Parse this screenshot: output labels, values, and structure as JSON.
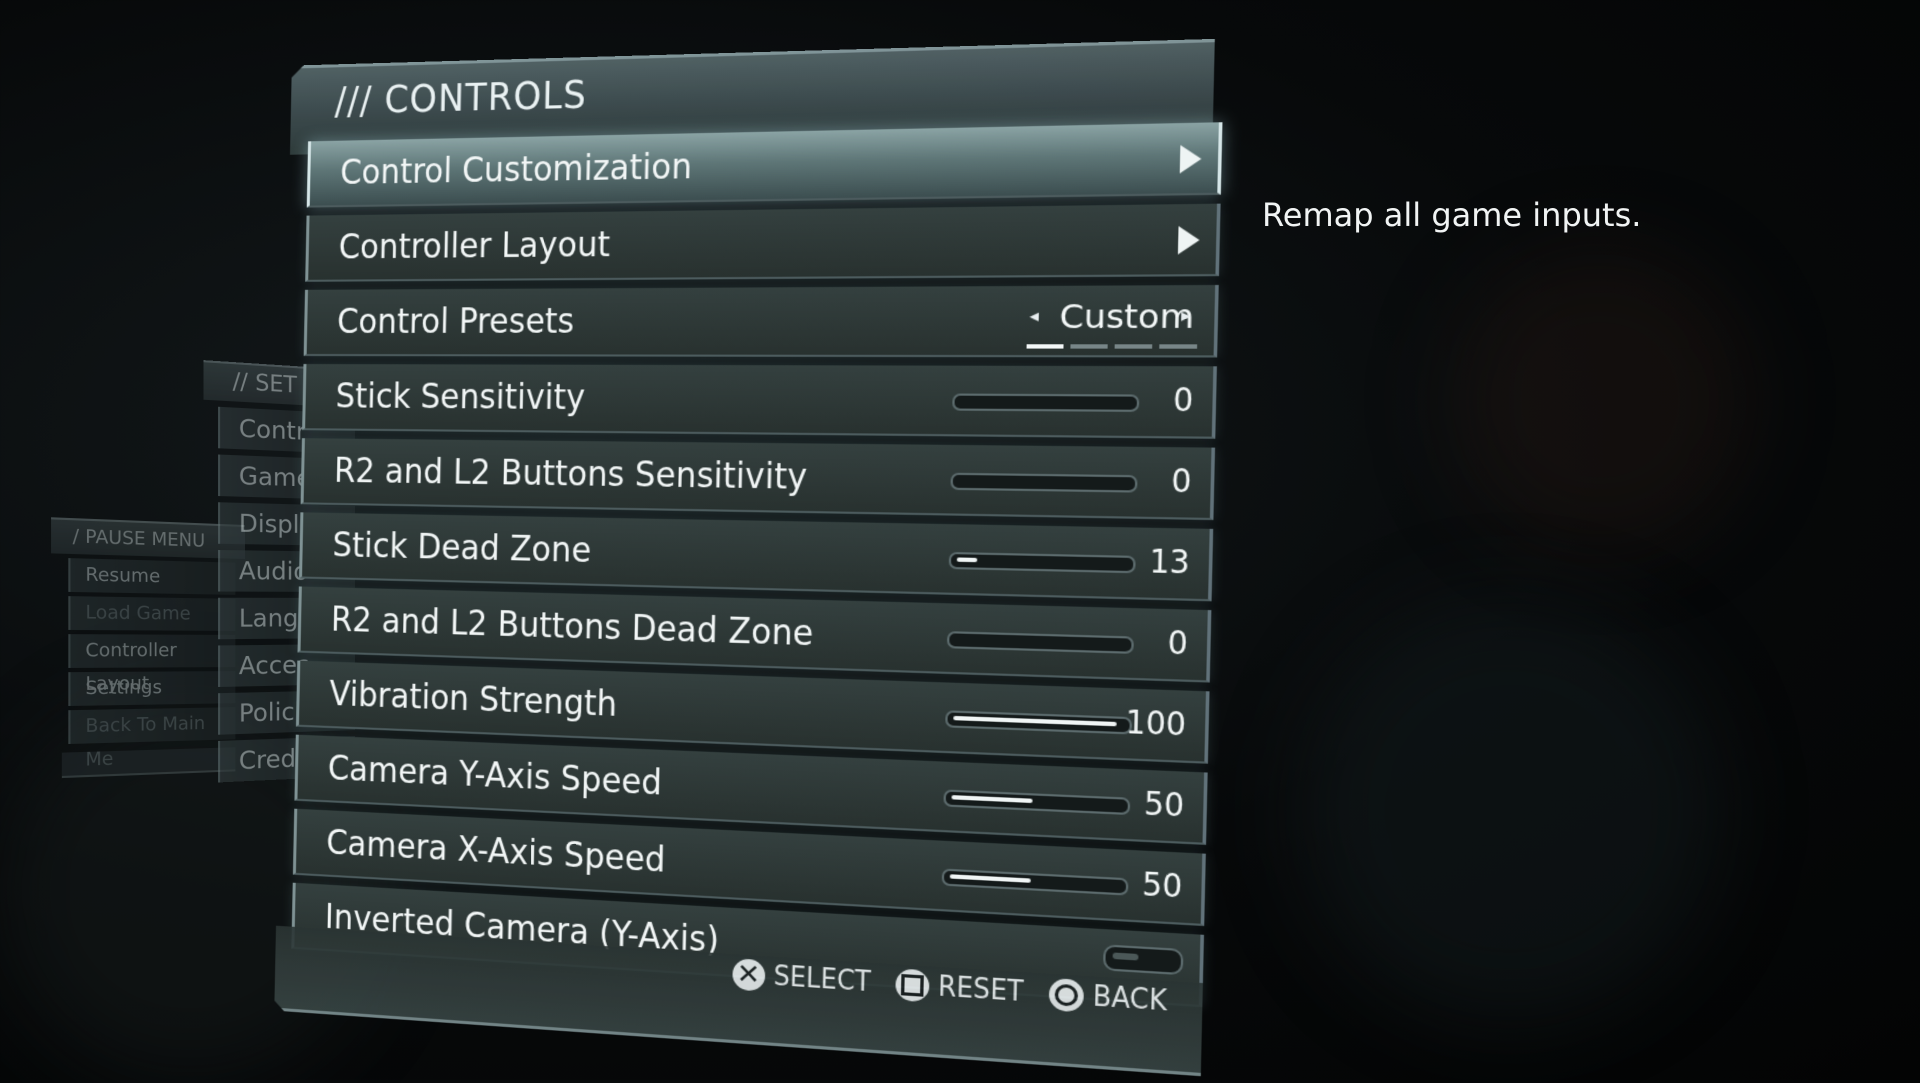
{
  "description": "Remap all game inputs.",
  "pause_menu": {
    "title": "/ PAUSE MENU",
    "items": [
      "Resume",
      "Load Game",
      "Controller Layout",
      "Settings",
      "Back To Main Me"
    ]
  },
  "settings_menu": {
    "title": "// SET",
    "items": [
      "Contr",
      "Game",
      "Displa",
      "Audio",
      "Langu",
      "Acces",
      "Policie",
      "Credit"
    ]
  },
  "controls": {
    "title": "/// CONTROLS",
    "rows": [
      {
        "label": "Control Customization",
        "type": "arrow",
        "selected": true
      },
      {
        "label": "Controller Layout",
        "type": "arrow"
      },
      {
        "label": "Control Presets",
        "type": "selector",
        "value": "Custom"
      },
      {
        "label": "Stick Sensitivity",
        "type": "slider",
        "value": "0",
        "fraction": 0
      },
      {
        "label": "R2 and L2 Buttons Sensitivity",
        "type": "slider",
        "value": "0",
        "fraction": 0
      },
      {
        "label": "Stick Dead Zone",
        "type": "slider",
        "value": "13",
        "fraction": 0.13
      },
      {
        "label": "R2 and L2 Buttons Dead Zone",
        "type": "slider",
        "value": "0",
        "fraction": 0
      },
      {
        "label": "Vibration Strength",
        "type": "slider",
        "value": "100",
        "fraction": 1
      },
      {
        "label": "Camera Y-Axis Speed",
        "type": "slider",
        "value": "50",
        "fraction": 0.5
      },
      {
        "label": "Camera X-Axis Speed",
        "type": "slider",
        "value": "50",
        "fraction": 0.5
      },
      {
        "label": "Inverted Camera (Y-Axis)",
        "type": "toggle",
        "value": "off"
      }
    ]
  },
  "footer": {
    "select_label": "SELECT",
    "reset_label": "RESET",
    "back_label": "BACK"
  }
}
